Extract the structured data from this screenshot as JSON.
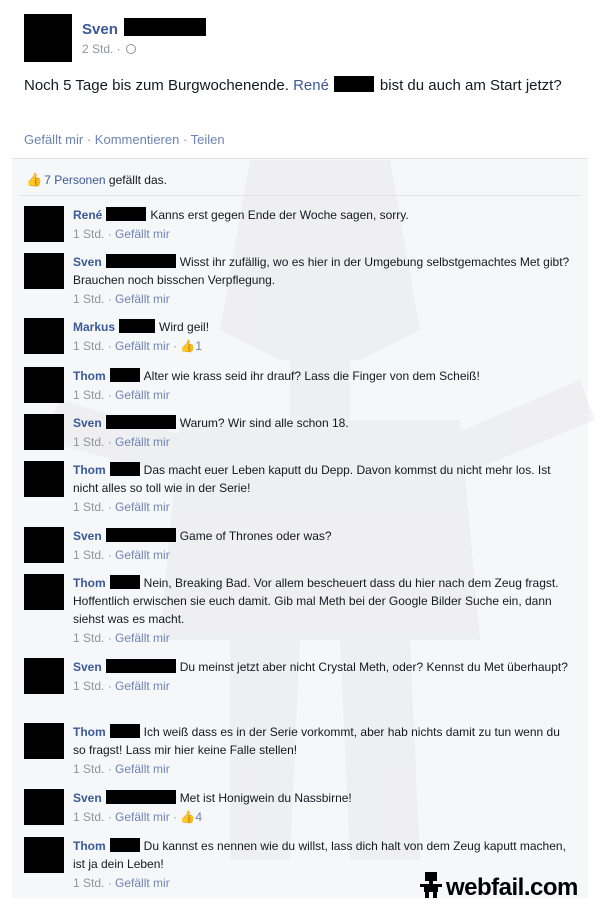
{
  "post": {
    "author": "Sven",
    "time": "2 Std. ·",
    "text_before": "Noch 5 Tage bis zum Burgwochenende.",
    "mention": "René",
    "text_after": "bist du auch am Start jetzt?",
    "actions": {
      "like": "Gefällt mir",
      "comment": "Kommentieren",
      "share": "Teilen",
      "separator": " · "
    }
  },
  "likes": {
    "count_label": "7 Personen",
    "suffix": "gefällt das."
  },
  "comments": [
    {
      "name": "René",
      "redact_w": 40,
      "text": "Kanns erst gegen Ende der Woche sagen, sorry.",
      "time": "1 Std.",
      "like_label": "Gefällt mir",
      "likes": ""
    },
    {
      "name": "Sven",
      "redact_w": 70,
      "text": "Wisst ihr zufällig, wo es hier in der Umgebung selbstgemachtes Met gibt? Brauchen noch bisschen Verpflegung.",
      "time": "1 Std.",
      "like_label": "Gefällt mir",
      "likes": ""
    },
    {
      "name": "Markus",
      "redact_w": 36,
      "text": "Wird geil!",
      "time": "1 Std.",
      "like_label": "Gefällt mir",
      "likes": "1"
    },
    {
      "name": "Thom",
      "redact_w": 30,
      "text": "Alter wie krass seid ihr drauf? Lass die Finger von dem Scheiß!",
      "time": "1 Std.",
      "like_label": "Gefällt mir",
      "likes": ""
    },
    {
      "name": "Sven",
      "redact_w": 70,
      "text": "Warum? Wir sind alle schon 18.",
      "time": "1 Std.",
      "like_label": "Gefällt mir",
      "likes": ""
    },
    {
      "name": "Thom",
      "redact_w": 30,
      "text": "Das macht euer Leben kaputt du Depp. Davon kommst du nicht mehr los. Ist nicht alles so toll wie in der Serie!",
      "time": "1 Std.",
      "like_label": "Gefällt mir",
      "likes": ""
    },
    {
      "name": "Sven",
      "redact_w": 70,
      "text": "Game of Thrones oder was?",
      "time": "1 Std.",
      "like_label": "Gefällt mir",
      "likes": ""
    },
    {
      "name": "Thom",
      "redact_w": 30,
      "text": "Nein, Breaking Bad. Vor allem bescheuert dass du hier nach dem Zeug fragst. Hoffentlich erwischen sie euch damit. Gib mal Meth bei der Google Bilder Suche ein, dann siehst was es macht.",
      "time": "1 Std.",
      "like_label": "Gefällt mir",
      "likes": ""
    },
    {
      "name": "Sven",
      "redact_w": 70,
      "text": "Du meinst jetzt aber nicht Crystal Meth, oder? Kennst du Met überhaupt?",
      "time": "1 Std.",
      "like_label": "Gefällt mir",
      "likes": ""
    },
    {
      "name": "Thom",
      "redact_w": 30,
      "text": "Ich weiß dass es in der Serie vorkommt, aber hab nichts damit zu tun wenn du so fragst! Lass mir hier keine Falle stellen!",
      "time": "1 Std.",
      "like_label": "Gefällt mir",
      "likes": ""
    },
    {
      "name": "Sven",
      "redact_w": 70,
      "text": "Met ist Honigwein du Nassbirne!",
      "time": "1 Std.",
      "like_label": "Gefällt mir",
      "likes": "4"
    },
    {
      "name": "Thom",
      "redact_w": 30,
      "text": "Du kannst es nennen wie du willst, lass dich halt von dem Zeug kaputt machen, ist ja dein Leben!",
      "time": "1 Std.",
      "like_label": "Gefällt mir",
      "likes": ""
    }
  ],
  "watermark": {
    "brand": "webfail.com"
  },
  "colors": {
    "link": "#3b5998",
    "meta": "#90949c",
    "panel": "#f6f7f9"
  }
}
